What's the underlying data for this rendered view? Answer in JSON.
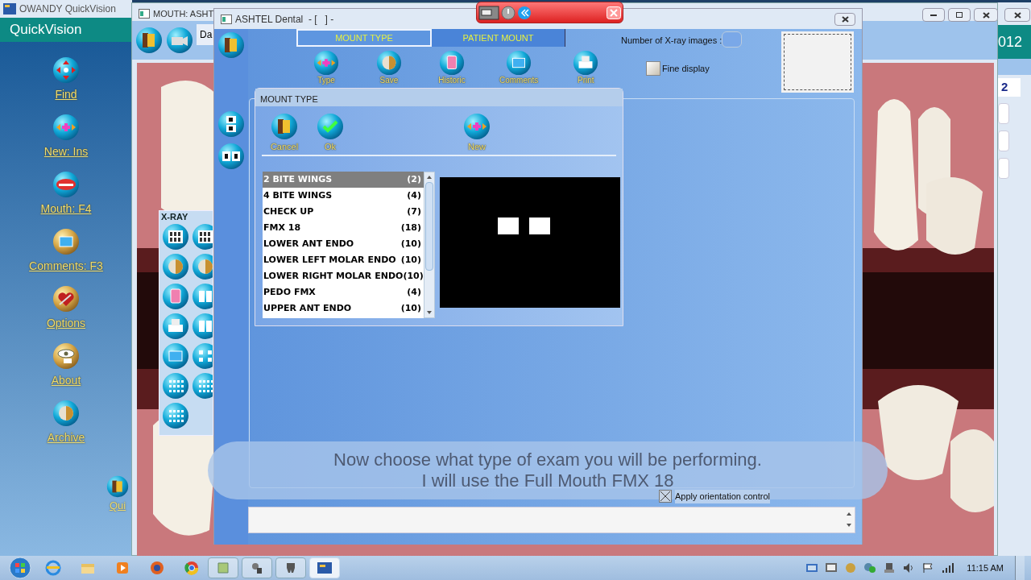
{
  "quickvision_window": {
    "title": "OWANDY QuickVision",
    "header": "QuickVision",
    "menu": [
      {
        "label": "Find"
      },
      {
        "label": "New: Ins"
      },
      {
        "label": "Mouth: F4"
      },
      {
        "label": "Comments: F3"
      },
      {
        "label": "Options"
      },
      {
        "label": "About"
      },
      {
        "label": "Archive"
      }
    ],
    "quit_label": "Qui"
  },
  "mouth_window": {
    "title": "MOUTH: ASHT",
    "date_tab": "Da"
  },
  "side_window": {
    "header": "012",
    "number": "2"
  },
  "dental_window": {
    "title": "ASHTEL Dental  - [   ] -",
    "tabs": [
      {
        "label": "MOUNT TYPE",
        "selected": true
      },
      {
        "label": "PATIENT MOUNT",
        "selected": false
      }
    ],
    "toolbar": [
      {
        "label": "Type"
      },
      {
        "label": "Save"
      },
      {
        "label": "Historic"
      },
      {
        "label": "Comments"
      },
      {
        "label": "Print"
      }
    ],
    "xray_count_label": "Number of X-ray images :",
    "fine_display": {
      "label": "Fine display",
      "checked": false
    },
    "apply_orientation": {
      "label": "Apply orientation control",
      "checked": true
    }
  },
  "xray_palette": {
    "title": "X-RAY"
  },
  "mount_dialog": {
    "title": "MOUNT TYPE",
    "buttons": [
      {
        "label": "Cancel"
      },
      {
        "label": "Ok"
      },
      {
        "label": "New"
      }
    ],
    "mounts": [
      {
        "name": "2 BITE WINGS",
        "count": "(2)",
        "selected": true
      },
      {
        "name": "4 BITE WINGS",
        "count": "(4)",
        "selected": false
      },
      {
        "name": "CHECK UP",
        "count": "(7)",
        "selected": false
      },
      {
        "name": "FMX 18",
        "count": "(18)",
        "selected": false
      },
      {
        "name": "LOWER ANT ENDO",
        "count": "(10)",
        "selected": false
      },
      {
        "name": "LOWER LEFT MOLAR ENDO",
        "count": "(10)",
        "selected": false
      },
      {
        "name": "LOWER RIGHT MOLAR ENDO",
        "count": "(10)",
        "selected": false
      },
      {
        "name": "PEDO FMX",
        "count": "(4)",
        "selected": false
      },
      {
        "name": "UPPER ANT ENDO",
        "count": "(10)",
        "selected": false
      }
    ]
  },
  "caption": [
    "Now choose what type of exam you will be performing.",
    "I will use the Full Mouth FMX 18"
  ],
  "taskbar": {
    "clock": "11:15 AM"
  }
}
